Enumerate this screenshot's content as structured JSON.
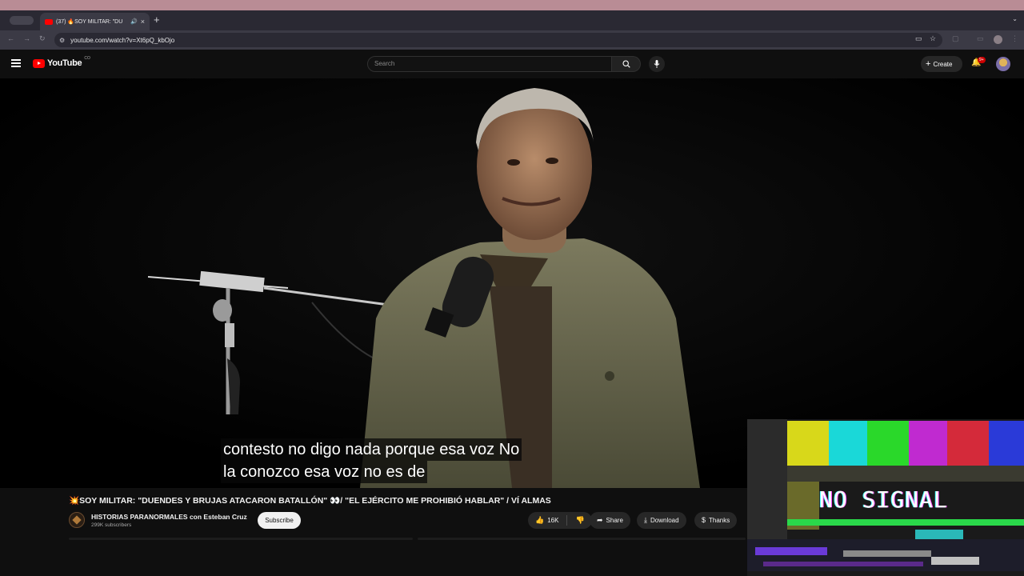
{
  "browser": {
    "tab_title": "(37) 🔥SOY MILITAR: \"DU",
    "url": "youtube.com/watch?v=Xt6pQ_kbOjo",
    "colors": {
      "menubar": "#b98c95",
      "tabstrip": "#2a2933",
      "toolbar": "#3b3a45"
    }
  },
  "youtube": {
    "logo_text": "YouTube",
    "logo_superscript": "CO",
    "search_placeholder": "Search",
    "create_label": "Create",
    "notification_count": "9+",
    "colors": {
      "brand": "#ff0000",
      "background": "#0f0f0f"
    }
  },
  "video": {
    "caption_line1": "contesto no digo nada porque esa voz No",
    "caption_line2": "la conozco esa voz no es de",
    "title_text": "SOY MILITAR: \"DUENDES Y BRUJAS ATACARON BATALLÓN\" 👀/ \"EL EJÉRCITO ME PROHIBIÓ HABLAR\" / VÍ ALMAS",
    "title_prefix_icon": "💥",
    "channel_name": "HISTORIAS PARANORMALES con Esteban Cruz",
    "subscribers": "299K subscribers",
    "subscribe_label": "Subscribe",
    "like_count": "16K",
    "share_label": "Share",
    "download_label": "Download",
    "thanks_label": "Thanks"
  },
  "overlay": {
    "no_signal_text": "NO SIGNAL"
  }
}
